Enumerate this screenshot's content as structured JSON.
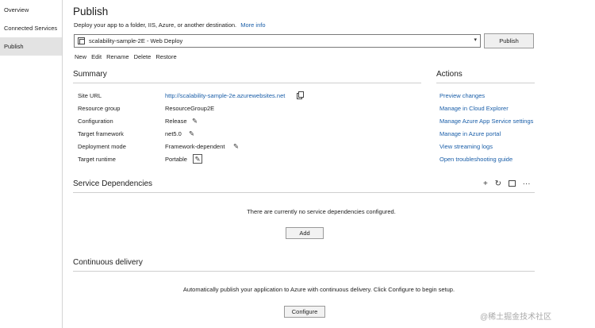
{
  "sidebar": {
    "items": [
      {
        "label": "Overview"
      },
      {
        "label": "Connected Services"
      },
      {
        "label": "Publish"
      }
    ]
  },
  "header": {
    "title": "Publish",
    "subtitle": "Deploy your app to a folder, IIS, Azure, or another destination.",
    "more_info": "More info"
  },
  "profile": {
    "selected": "scalability-sample-2E - Web Deploy",
    "publish_label": "Publish",
    "actions": [
      "New",
      "Edit",
      "Rename",
      "Delete",
      "Restore"
    ]
  },
  "summary": {
    "heading": "Summary",
    "rows": [
      {
        "label": "Site URL",
        "value": "http://scalability-sample-2e.azurewebsites.net"
      },
      {
        "label": "Resource group",
        "value": "ResourceGroup2E"
      },
      {
        "label": "Configuration",
        "value": "Release"
      },
      {
        "label": "Target framework",
        "value": "net5.0"
      },
      {
        "label": "Deployment mode",
        "value": "Framework-dependent"
      },
      {
        "label": "Target runtime",
        "value": "Portable"
      }
    ]
  },
  "actions": {
    "heading": "Actions",
    "links": [
      "Preview changes",
      "Manage in Cloud Explorer",
      "Manage Azure App Service settings",
      "Manage in Azure portal",
      "View streaming logs",
      "Open troubleshooting guide"
    ]
  },
  "service_dependencies": {
    "heading": "Service Dependencies",
    "empty_message": "There are currently no service dependencies configured.",
    "add_label": "Add",
    "tools": {
      "add": "+",
      "refresh": "↻",
      "more": "···"
    }
  },
  "continuous_delivery": {
    "heading": "Continuous delivery",
    "message": "Automatically publish your application to Azure with continuous delivery. Click Configure to begin setup.",
    "configure_label": "Configure"
  },
  "icons": {
    "edit": "✎",
    "dropdown": "▾"
  },
  "watermark": "@稀土掘金技术社区"
}
